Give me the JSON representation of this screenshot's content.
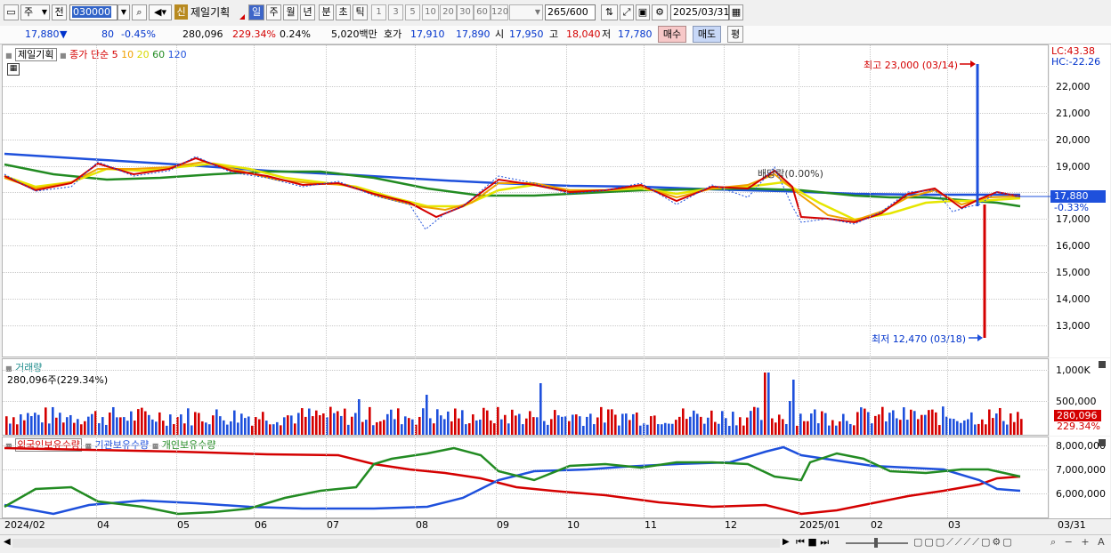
{
  "toolbar": {
    "type_select": "주",
    "prev_label": "전",
    "code_value": "030000",
    "stock_name": "제일기획",
    "new_badge": "신",
    "periods": [
      "일",
      "주",
      "월",
      "년",
      "분",
      "초",
      "틱"
    ],
    "intervals": [
      "1",
      "3",
      "5",
      "10",
      "20",
      "30",
      "60",
      "120"
    ],
    "count_value": "265",
    "count_total": "/600",
    "date_value": "2025/03/31"
  },
  "quote": {
    "price": "17,880",
    "change_arrow": "▼",
    "change": "80",
    "change_pct": "-0.45%",
    "volume": "280,096",
    "volume_ratio": "229.34%",
    "turnover": "0.24%",
    "amount": "5,020백만",
    "hoga_label": "호가",
    "ask": "17,910",
    "bid": "17,890",
    "open_label": "시",
    "open": "17,950",
    "high_label": "고",
    "high": "18,040",
    "low_label": "저",
    "low": "17,780",
    "buy_button": "매수",
    "sell_button": "매도",
    "avg_button": "평"
  },
  "price_panel": {
    "title": "제일기획",
    "ma_label": "종가 단순",
    "ma_periods": [
      "5",
      "10",
      "20",
      "60",
      "120"
    ],
    "ma_colors": [
      "#d40000",
      "#f0a000",
      "#e6e600",
      "#228b22",
      "#1e50dc"
    ],
    "lc": "LC:43.38",
    "hc": "HC:-22.26",
    "max_label": "최고 23,000 (03/14)",
    "min_label": "최저 12,470 (03/18)",
    "event_label": "배당락(0.00%)",
    "current_tag": "17,880",
    "current_pct": "-0.33%",
    "y_ticks": [
      "22,000",
      "21,000",
      "20,000",
      "19,000",
      "18,000",
      "17,000",
      "16,000",
      "15,000",
      "14,000",
      "13,000"
    ]
  },
  "volume_panel": {
    "title": "거래량",
    "readout": "280,096주(229.34%)",
    "y_ticks": [
      "1,000K",
      "500,000"
    ],
    "current_tag": "280,096",
    "current_pct": "229.34%"
  },
  "holdings_panel": {
    "legend": [
      "외국인보유수량",
      "기관보유수량",
      "개인보유수량"
    ],
    "y_ticks": [
      "8,000,000",
      "7,000,000",
      "6,000,000"
    ]
  },
  "x_axis": {
    "labels": [
      "2024/02",
      "04",
      "05",
      "06",
      "07",
      "08",
      "09",
      "10",
      "11",
      "12",
      "2025/01",
      "02",
      "03"
    ],
    "last_label": "03/31"
  }
}
